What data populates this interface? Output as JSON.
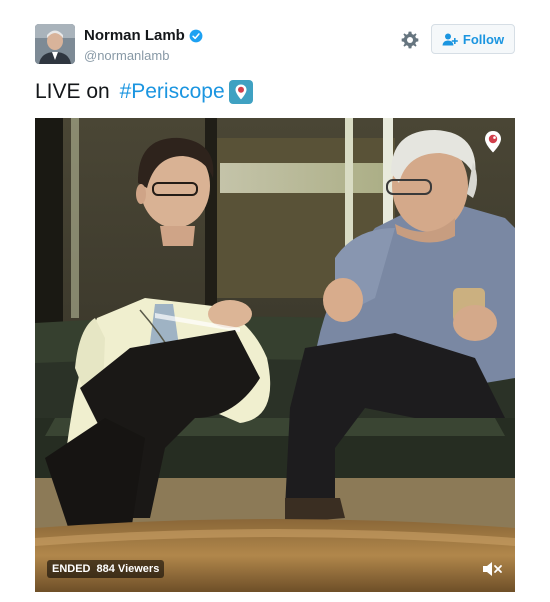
{
  "user": {
    "display_name": "Norman Lamb",
    "handle": "@normanlamb",
    "verified": true
  },
  "actions": {
    "follow_label": "Follow",
    "settings_icon": "gear-icon",
    "follow_icon": "add-person-icon"
  },
  "tweet": {
    "text_prefix": "LIVE on ",
    "hashtag": "#Periscope",
    "badge_icon": "periscope-icon"
  },
  "video": {
    "status": "ENDED",
    "viewers": "884 Viewers",
    "mute_icon": "muted-speaker-icon",
    "watermark_icon": "periscope-icon"
  },
  "colors": {
    "accent": "#1b95e0",
    "periscope": "#3fa1c2",
    "periscope_red": "#d23f4c",
    "text": "#14171a",
    "muted": "#8899a6"
  }
}
